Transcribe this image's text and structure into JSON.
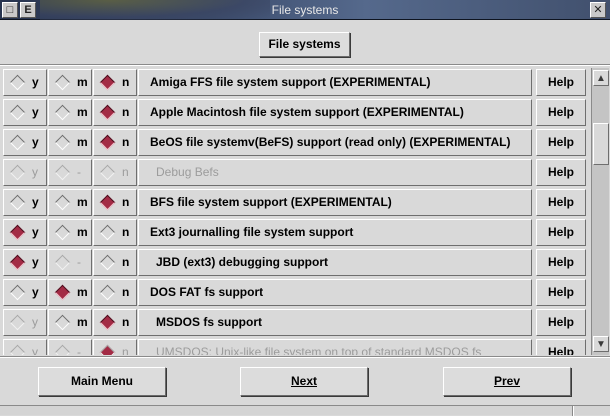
{
  "window": {
    "title": "File systems",
    "menu_glyph": "□",
    "e_glyph": "E",
    "close_glyph": "✕"
  },
  "header_button": {
    "label": "File systems"
  },
  "tristate_labels": {
    "y": "y",
    "m": "m",
    "n": "n",
    "disabled": "-"
  },
  "help_label": "Help",
  "options": [
    {
      "label": "Amiga FFS file system support (EXPERIMENTAL)",
      "value": "n",
      "m_enabled": true,
      "y_enabled": true,
      "enabled": true,
      "indent": false
    },
    {
      "label": "Apple Macintosh file system support (EXPERIMENTAL)",
      "value": "n",
      "m_enabled": true,
      "y_enabled": true,
      "enabled": true,
      "indent": false
    },
    {
      "label": "BeOS file systemv(BeFS) support (read only) (EXPERIMENTAL)",
      "value": "n",
      "m_enabled": true,
      "y_enabled": true,
      "enabled": true,
      "indent": false
    },
    {
      "label": "Debug Befs",
      "value": "none",
      "m_enabled": false,
      "y_enabled": false,
      "enabled": false,
      "indent": true
    },
    {
      "label": "BFS file system support (EXPERIMENTAL)",
      "value": "n",
      "m_enabled": true,
      "y_enabled": true,
      "enabled": true,
      "indent": false
    },
    {
      "label": "Ext3 journalling file system support",
      "value": "y",
      "m_enabled": true,
      "y_enabled": true,
      "enabled": true,
      "indent": false
    },
    {
      "label": "JBD (ext3) debugging support",
      "value": "y",
      "m_enabled": false,
      "y_enabled": true,
      "enabled": true,
      "indent": true
    },
    {
      "label": "DOS FAT fs support",
      "value": "m",
      "m_enabled": true,
      "y_enabled": true,
      "enabled": true,
      "indent": false
    },
    {
      "label": "MSDOS fs support",
      "value": "n",
      "m_enabled": true,
      "y_enabled": false,
      "enabled": true,
      "indent": true
    },
    {
      "label": "UMSDOS: Unix-like file system on top of standard MSDOS fs",
      "value": "n",
      "m_enabled": true,
      "y_enabled": false,
      "enabled": false,
      "indent": true
    }
  ],
  "scrollbar": {
    "up_glyph": "▲",
    "down_glyph": "▼",
    "position": 0.15
  },
  "footer": {
    "main_menu": "Main Menu",
    "next": "Next",
    "prev": "Prev"
  }
}
